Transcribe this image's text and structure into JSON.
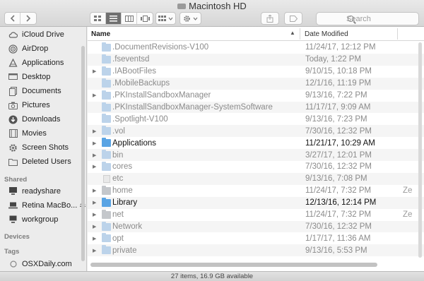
{
  "window": {
    "title": "Macintosh HD"
  },
  "toolbar": {
    "back_icon": "chevron-left-icon",
    "forward_icon": "chevron-right-icon",
    "view_modes": [
      "icon-view",
      "list-view",
      "column-view",
      "cover-flow-view"
    ],
    "active_view": "list-view",
    "search_placeholder": "Search"
  },
  "sidebar": {
    "favorites": [
      {
        "label": "iCloud Drive",
        "icon": "cloud-icon"
      },
      {
        "label": "AirDrop",
        "icon": "airdrop-icon"
      },
      {
        "label": "Applications",
        "icon": "applications-icon"
      },
      {
        "label": "Desktop",
        "icon": "desktop-icon"
      },
      {
        "label": "Documents",
        "icon": "documents-icon"
      },
      {
        "label": "Pictures",
        "icon": "camera-icon"
      },
      {
        "label": "Downloads",
        "icon": "downloads-icon"
      },
      {
        "label": "Movies",
        "icon": "film-icon"
      },
      {
        "label": "Screen Shots",
        "icon": "gear-folder-icon"
      },
      {
        "label": "Deleted Users",
        "icon": "folder-icon"
      }
    ],
    "shared_heading": "Shared",
    "shared": [
      {
        "label": "readyshare",
        "icon": "monitor-icon"
      },
      {
        "label": "Retina MacBo...",
        "icon": "laptop-icon"
      },
      {
        "label": "workgroup",
        "icon": "network-icon"
      }
    ],
    "devices_heading": "Devices",
    "tags_heading": "Tags",
    "tags": [
      {
        "label": "OSXDaily.com",
        "icon": "tag-circle-icon"
      }
    ]
  },
  "list": {
    "columns": {
      "name": "Name",
      "date_modified": "Date Modified"
    },
    "rows": [
      {
        "name": ".DocumentRevisions-V100",
        "date": "11/24/17, 12:12 PM",
        "kind": "folder-locked",
        "disclosure": false,
        "hidden": true
      },
      {
        "name": ".fseventsd",
        "date": "Today, 1:22 PM",
        "kind": "folder-locked",
        "disclosure": false,
        "hidden": true
      },
      {
        "name": ".IABootFiles",
        "date": "9/10/15, 10:18 PM",
        "kind": "folder",
        "disclosure": true,
        "hidden": true
      },
      {
        "name": ".MobileBackups",
        "date": "12/1/16, 11:19 PM",
        "kind": "folder-locked",
        "disclosure": false,
        "hidden": true
      },
      {
        "name": ".PKInstallSandboxManager",
        "date": "9/13/16, 7:22 PM",
        "kind": "folder",
        "disclosure": true,
        "hidden": true
      },
      {
        "name": ".PKInstallSandboxManager-SystemSoftware",
        "date": "11/17/17, 9:09 AM",
        "kind": "folder-locked",
        "disclosure": false,
        "hidden": true
      },
      {
        "name": ".Spotlight-V100",
        "date": "9/13/16, 7:23 PM",
        "kind": "folder-locked",
        "disclosure": false,
        "hidden": true
      },
      {
        "name": ".vol",
        "date": "7/30/16, 12:32 PM",
        "kind": "folder",
        "disclosure": true,
        "hidden": true
      },
      {
        "name": "Applications",
        "date": "11/21/17, 10:29 AM",
        "kind": "folder-app",
        "disclosure": true,
        "hidden": false
      },
      {
        "name": "bin",
        "date": "3/27/17, 12:01 PM",
        "kind": "folder",
        "disclosure": true,
        "hidden": true
      },
      {
        "name": "cores",
        "date": "7/30/16, 12:32 PM",
        "kind": "folder",
        "disclosure": true,
        "hidden": true
      },
      {
        "name": "etc",
        "date": "9/13/16, 7:08 PM",
        "kind": "file",
        "disclosure": false,
        "hidden": true
      },
      {
        "name": "home",
        "date": "11/24/17, 7:32 PM",
        "kind": "folder-gray",
        "disclosure": true,
        "hidden": true,
        "extra": "Ze"
      },
      {
        "name": "Library",
        "date": "12/13/16, 12:14 PM",
        "kind": "folder-library",
        "disclosure": true,
        "hidden": false
      },
      {
        "name": "net",
        "date": "11/24/17, 7:32 PM",
        "kind": "folder-gray",
        "disclosure": true,
        "hidden": true,
        "extra": "Ze"
      },
      {
        "name": "Network",
        "date": "7/30/16, 12:32 PM",
        "kind": "folder",
        "disclosure": true,
        "hidden": true
      },
      {
        "name": "opt",
        "date": "1/17/17, 11:36 AM",
        "kind": "folder",
        "disclosure": true,
        "hidden": true
      },
      {
        "name": "private",
        "date": "9/13/16, 5:53 PM",
        "kind": "folder",
        "disclosure": true,
        "hidden": true
      }
    ]
  },
  "status": {
    "text": "27 items, 16.9 GB available"
  }
}
